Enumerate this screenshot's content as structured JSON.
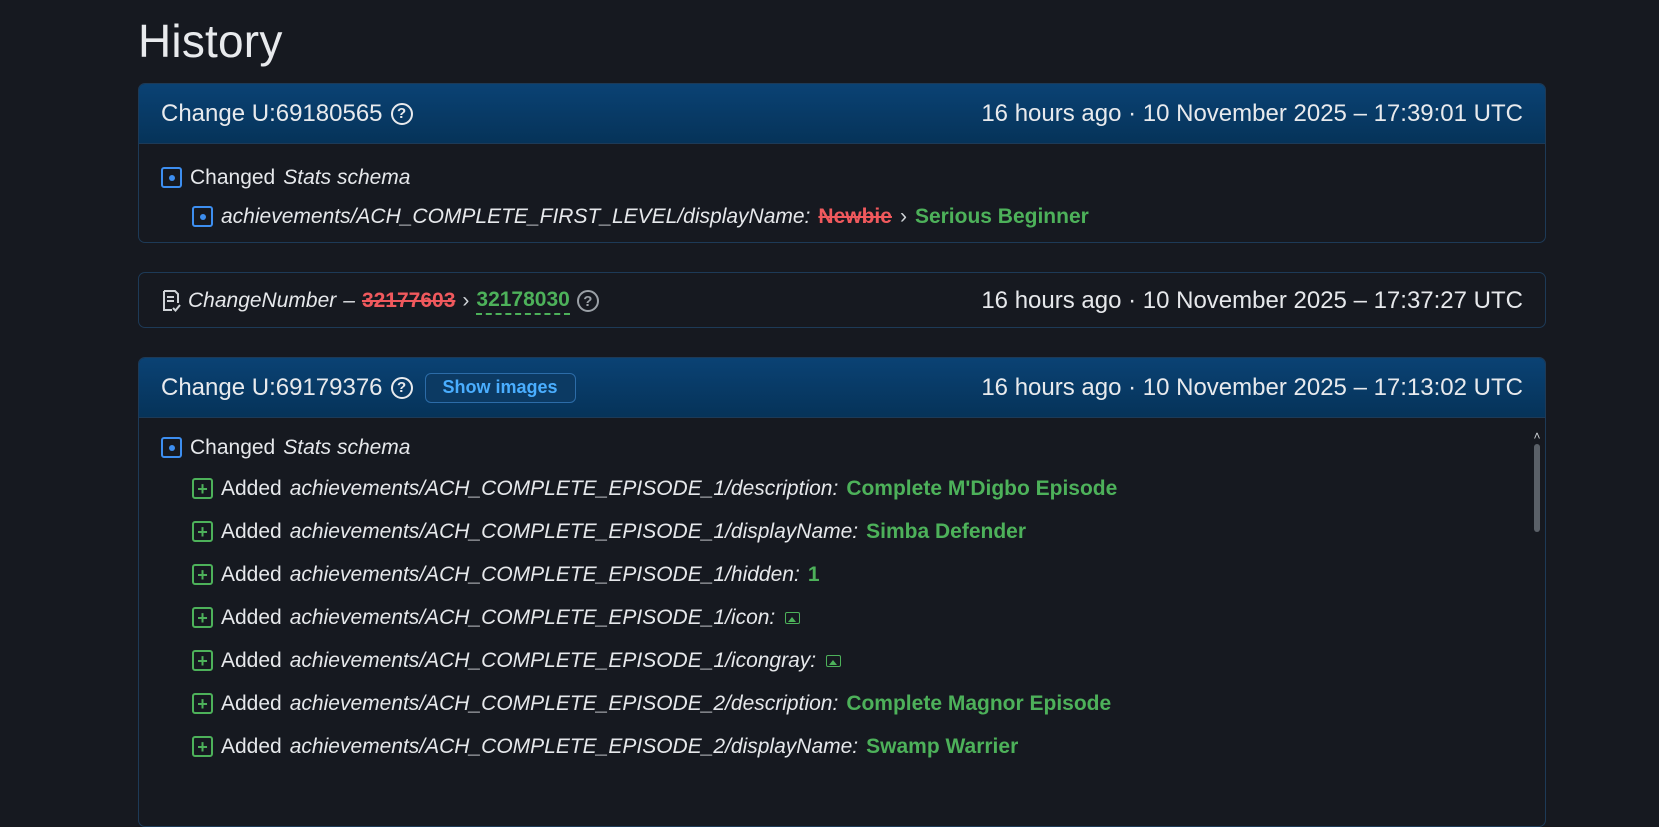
{
  "page": {
    "title": "History"
  },
  "colors": {
    "header_bg": "#063359",
    "added_green": "#4db15a",
    "removed_red": "#f0595d",
    "changed_blue": "#3d8ef0",
    "link_blue": "#4aaeff"
  },
  "icons": {
    "changed": "square-dot-icon",
    "added": "square-plus-icon",
    "help": "question-circle-icon",
    "image": "image-icon",
    "document": "document-check-icon"
  },
  "change1": {
    "title": "Change U:69180565",
    "time": "16 hours ago · 10 November 2025 – 17:39:01 UTC",
    "section": {
      "prefix": "Changed",
      "name": "Stats schema"
    },
    "item": {
      "key": "achievements/ACH_COMPLETE_FIRST_LEVEL/displayName:",
      "old": "Newbie",
      "arrow": "›",
      "new": "Serious Beginner"
    }
  },
  "change2": {
    "label": "ChangeNumber",
    "dash": "–",
    "old": "32177603",
    "arrow": "›",
    "new": "32178030",
    "time": "16 hours ago · 10 November 2025 – 17:37:27 UTC"
  },
  "change3": {
    "title": "Change U:69179376",
    "show_images": "Show images",
    "time": "16 hours ago · 10 November 2025 – 17:13:02 UTC",
    "section": {
      "prefix": "Changed",
      "name": "Stats schema"
    },
    "items": [
      {
        "verb": "Added",
        "key": "achievements/ACH_COMPLETE_EPISODE_1/description:",
        "value": "Complete M'Digbo Episode"
      },
      {
        "verb": "Added",
        "key": "achievements/ACH_COMPLETE_EPISODE_1/displayName:",
        "value": "Simba Defender"
      },
      {
        "verb": "Added",
        "key": "achievements/ACH_COMPLETE_EPISODE_1/hidden:",
        "value": "1"
      },
      {
        "verb": "Added",
        "key": "achievements/ACH_COMPLETE_EPISODE_1/icon:",
        "value": ""
      },
      {
        "verb": "Added",
        "key": "achievements/ACH_COMPLETE_EPISODE_1/icongray:",
        "value": ""
      },
      {
        "verb": "Added",
        "key": "achievements/ACH_COMPLETE_EPISODE_2/description:",
        "value": "Complete Magnor Episode"
      },
      {
        "verb": "Added",
        "key": "achievements/ACH_COMPLETE_EPISODE_2/displayName:",
        "value": "Swamp Warrier"
      }
    ]
  }
}
